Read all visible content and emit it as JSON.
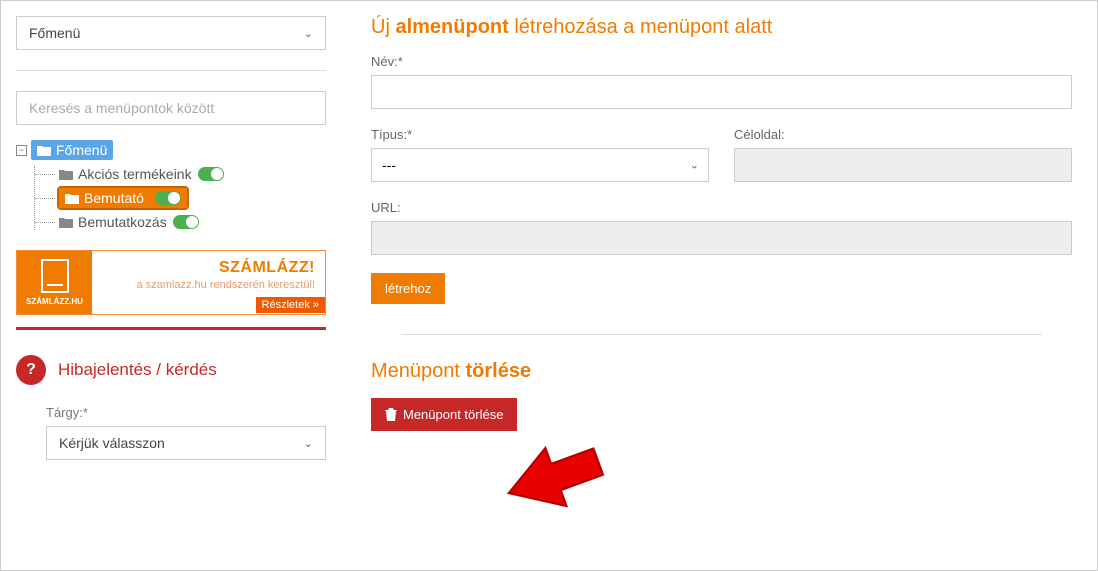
{
  "sidebar": {
    "menu_select_value": "Főmenü",
    "search_placeholder": "Keresés a menüpontok között",
    "tree_root": "Főmenü",
    "tree_items": [
      {
        "label": "Akciós termékeink",
        "selected": false
      },
      {
        "label": "Bemutató",
        "selected": true
      },
      {
        "label": "Bemutatkozás",
        "selected": false
      }
    ],
    "banner": {
      "logo_text": "SZÁMLÁZZ.HU",
      "title": "SZÁMLÁZZ!",
      "subtitle": "a szamlazz.hu rendszerén keresztül!",
      "link": "Részletek »"
    },
    "help": {
      "title": "Hibajelentés / kérdés",
      "subject_label": "Tárgy:*",
      "subject_value": "Kérjük válasszon"
    }
  },
  "main": {
    "create_heading_pre": "Új ",
    "create_heading_strong": "almenüpont",
    "create_heading_post": " létrehozása a menüpont alatt",
    "name_label": "Név:*",
    "name_value": "",
    "type_label": "Típus:*",
    "type_value": "---",
    "target_label": "Céloldal:",
    "target_value": "",
    "url_label": "URL:",
    "url_value": "",
    "create_button": "létrehoz",
    "delete_heading_pre": "Menüpont ",
    "delete_heading_strong": "törlése",
    "delete_button": "Menüpont törlése"
  }
}
